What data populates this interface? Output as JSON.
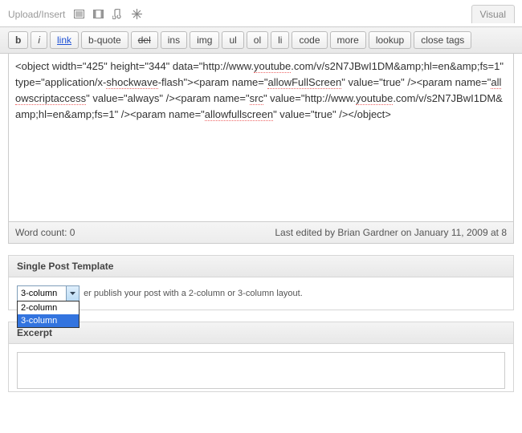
{
  "upload": {
    "label": "Upload/Insert"
  },
  "tabs": {
    "visual": "Visual"
  },
  "toolbar": {
    "bold": "b",
    "italic": "i",
    "link": "link",
    "bquote": "b-quote",
    "del": "del",
    "ins": "ins",
    "img": "img",
    "ul": "ul",
    "ol": "ol",
    "li": "li",
    "code": "code",
    "more": "more",
    "lookup": "lookup",
    "close": "close tags"
  },
  "editor": {
    "content": "<object width=\"425\" height=\"344\" data=\"http://www.youtube.com/v/s2N7JBwI1DM&amp;hl=en&amp;fs=1\" type=\"application/x-shockwave-flash\"><param name=\"allowFullScreen\" value=\"true\" /><param name=\"allowscriptaccess\" value=\"always\" /><param name=\"src\" value=\"http://www.youtube.com/v/s2N7JBwI1DM&amp;hl=en&amp;fs=1\" /><param name=\"allowfullscreen\" value=\"true\" /></object>"
  },
  "status": {
    "word_count": "Word count: 0",
    "last_edited": "Last edited by Brian Gardner on January 11, 2009 at 8"
  },
  "template": {
    "title": "Single Post Template",
    "selected": "3-column",
    "options": [
      "2-column",
      "3-column"
    ],
    "hint_tail": "er publish your post with a 2-column or 3-column layout."
  },
  "excerpt": {
    "title": "Excerpt"
  }
}
